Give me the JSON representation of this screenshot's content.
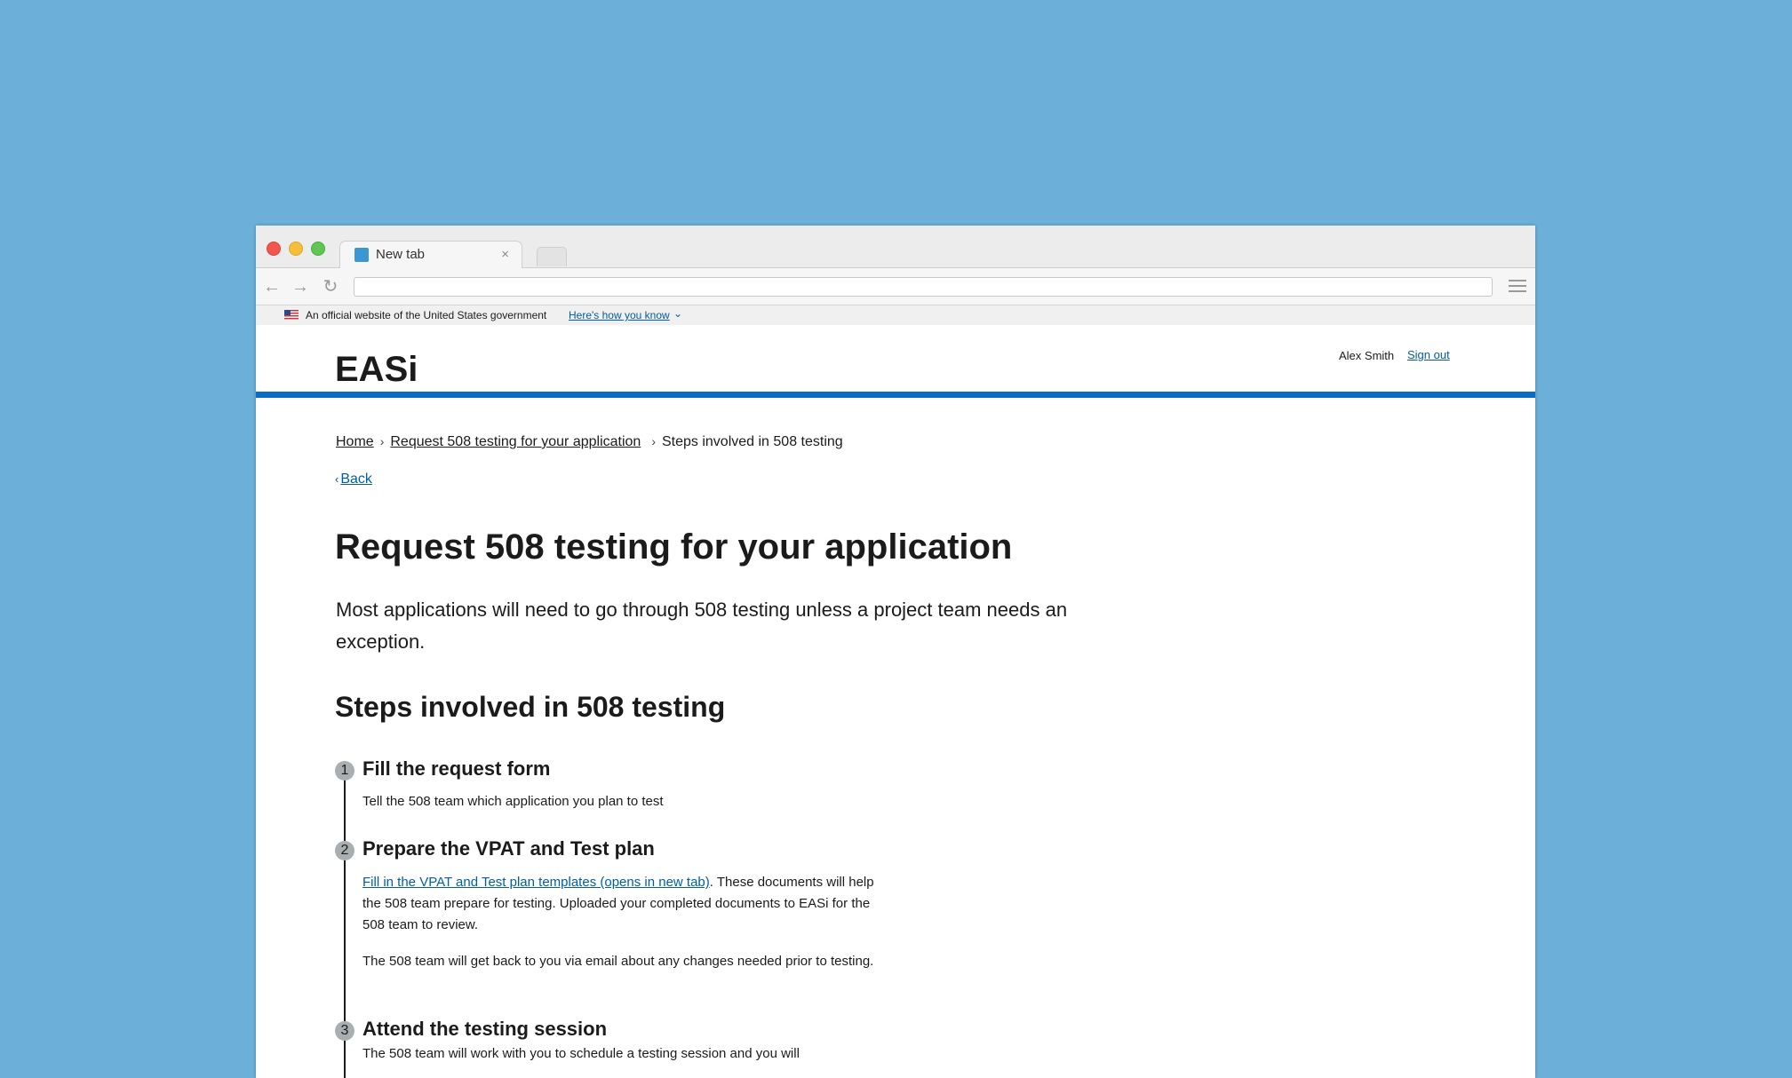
{
  "browser": {
    "tab_title": "New tab",
    "tab_close": "×"
  },
  "gov_banner": {
    "text": "An official website of the United States government",
    "link": "Here's how you know"
  },
  "header": {
    "logo": "EASi",
    "user_name": "Alex Smith",
    "sign_out": "Sign out",
    "accent_color": "#0a6cc4"
  },
  "breadcrumb": {
    "items": [
      "Home",
      "Request 508 testing for your application",
      "Steps involved in 508 testing"
    ]
  },
  "back_link": "Back",
  "page": {
    "title": "Request 508 testing for your application",
    "lead": "Most applications will need to go through 508 testing unless a project team needs an exception.",
    "section_title": "Steps involved in 508 testing"
  },
  "steps": [
    {
      "number": "1",
      "title": "Fill the request form",
      "text": "Tell the 508 team which application you plan to test"
    },
    {
      "number": "2",
      "title": "Prepare the VPAT and Test plan",
      "link": "Fill in the VPAT and Test plan templates (opens in new tab)",
      "text": ". These documents will help the 508 team prepare for testing. Uploaded your completed documents to EASi for the 508 team to review.",
      "text2": "The 508 team will get back to you via email about any changes needed prior to testing."
    },
    {
      "number": "3",
      "title": "Attend the testing session",
      "text": "The 508 team will work with you to schedule a testing session and you will"
    }
  ]
}
